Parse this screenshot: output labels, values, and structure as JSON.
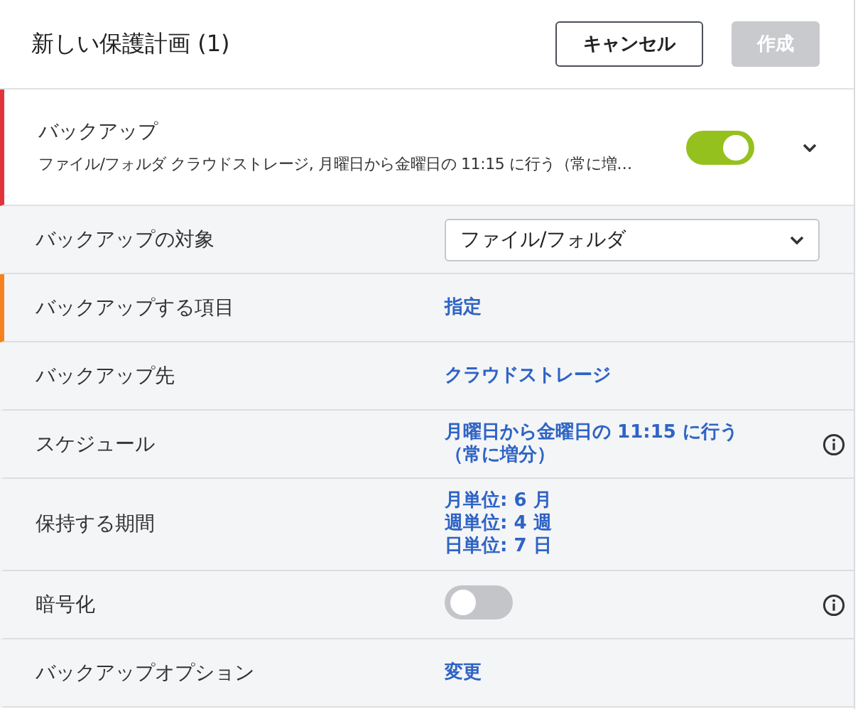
{
  "header": {
    "title": "新しい保護計画 (1)",
    "buttons": [
      {
        "kind": "outline",
        "label": "キャンセル",
        "disabled": false
      },
      {
        "kind": "primary",
        "label": "作成",
        "disabled": true
      }
    ]
  },
  "section": {
    "title": "バックアップ",
    "summary": "ファイル/フォルダ クラウドストレージ, 月曜日から金曜日の 11:15 に行う（常に増…",
    "on": true,
    "expanded": false,
    "flagged": true
  },
  "rows": [
    {
      "kind": "select",
      "label": "バックアップの対象",
      "value": "ファイル/フォルダ",
      "flagged": false,
      "info": false
    },
    {
      "kind": "link",
      "label": "バックアップする項目",
      "lines": [
        "指定"
      ],
      "flagged": true,
      "info": false
    },
    {
      "kind": "link",
      "label": "バックアップ先",
      "lines": [
        "クラウドストレージ"
      ],
      "flagged": false,
      "info": false
    },
    {
      "kind": "link",
      "label": "スケジュール",
      "lines": [
        "月曜日から金曜日の 11:15 に行う",
        "（常に増分）"
      ],
      "flagged": false,
      "info": true
    },
    {
      "kind": "link",
      "label": "保持する期間",
      "lines": [
        "月単位: 6 月",
        "週単位: 4 週",
        "日単位: 7 日"
      ],
      "flagged": false,
      "info": false
    },
    {
      "kind": "toggle",
      "label": "暗号化",
      "on": false,
      "flagged": false,
      "info": true
    },
    {
      "kind": "link",
      "label": "バックアップオプション",
      "lines": [
        "変更"
      ],
      "flagged": false,
      "info": false
    }
  ]
}
